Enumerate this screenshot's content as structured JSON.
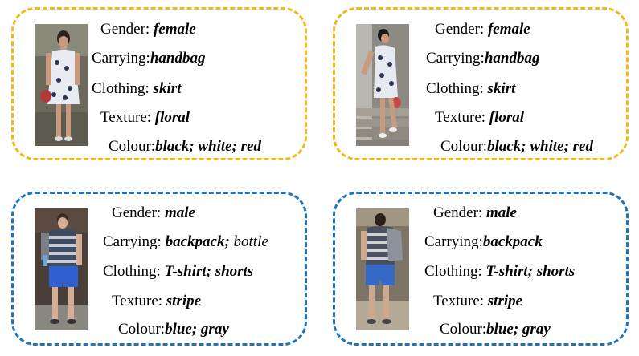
{
  "cards": [
    {
      "gender": "female",
      "attributes": [
        {
          "key": "Gender:",
          "value": "female"
        },
        {
          "key": "Carrying:",
          "value": "handbag"
        },
        {
          "key": "Clothing:",
          "value": "skirt"
        },
        {
          "key": "Texture:",
          "value": "floral"
        },
        {
          "key": "Colour:",
          "value": "black; white; red"
        }
      ]
    },
    {
      "gender": "female",
      "attributes": [
        {
          "key": "Gender:",
          "value": "female"
        },
        {
          "key": "Carrying:",
          "value": "handbag"
        },
        {
          "key": "Clothing:",
          "value": "skirt"
        },
        {
          "key": "Texture:",
          "value": "floral"
        },
        {
          "key": "Colour:",
          "value": "black; white; red"
        }
      ]
    },
    {
      "gender": "male",
      "attributes": [
        {
          "key": "Gender:",
          "value": "male"
        },
        {
          "key": "Carrying:",
          "value": "backpack;",
          "extra": " bottle"
        },
        {
          "key": "Clothing:",
          "value": "T-shirt; shorts"
        },
        {
          "key": "Texture:",
          "value": "stripe"
        },
        {
          "key": "Colour:",
          "value": "blue; gray"
        }
      ]
    },
    {
      "gender": "male",
      "attributes": [
        {
          "key": "Gender:",
          "value": "male"
        },
        {
          "key": "Carrying:",
          "value": "backpack"
        },
        {
          "key": "Clothing:",
          "value": "T-shirt; shorts"
        },
        {
          "key": "Texture:",
          "value": "stripe"
        },
        {
          "key": "Colour:",
          "value": "blue; gray"
        }
      ]
    }
  ],
  "colors": {
    "female_border": "#f3b81a",
    "male_border": "#1f74b9"
  }
}
